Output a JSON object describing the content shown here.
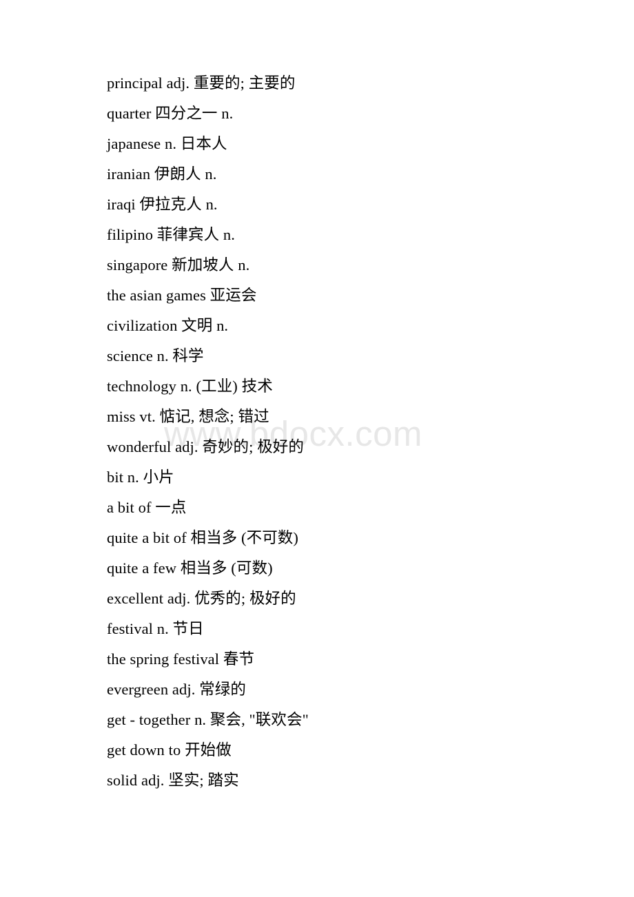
{
  "document": {
    "background_color": "#ffffff",
    "text_color": "#000000"
  },
  "watermark": {
    "text": "www.bdocx.com",
    "color": "#e7e7e7"
  },
  "vocabulary": {
    "entries": [
      {
        "text": "principal adj. 重要的; 主要的"
      },
      {
        "text": "quarter 四分之一 n."
      },
      {
        "text": "japanese n. 日本人"
      },
      {
        "text": "iranian 伊朗人 n."
      },
      {
        "text": "iraqi 伊拉克人 n."
      },
      {
        "text": "filipino 菲律宾人 n."
      },
      {
        "text": "singapore 新加坡人 n."
      },
      {
        "text": "the asian games 亚运会"
      },
      {
        "text": "civilization 文明 n."
      },
      {
        "text": "science n. 科学"
      },
      {
        "text": "technology n. (工业) 技术"
      },
      {
        "text": "miss vt. 惦记, 想念; 错过"
      },
      {
        "text": "wonderful adj. 奇妙的; 极好的"
      },
      {
        "text": "bit n. 小片"
      },
      {
        "text": "a bit of 一点"
      },
      {
        "text": "quite a bit of 相当多 (不可数)"
      },
      {
        "text": "quite a few 相当多 (可数)"
      },
      {
        "text": "excellent adj. 优秀的; 极好的"
      },
      {
        "text": "festival n. 节日"
      },
      {
        "text": "the spring festival 春节"
      },
      {
        "text": "evergreen adj. 常绿的"
      },
      {
        "text": "get - together n. 聚会, \"联欢会\""
      },
      {
        "text": "get down to 开始做"
      },
      {
        "text": "solid adj. 坚实; 踏实"
      }
    ]
  }
}
